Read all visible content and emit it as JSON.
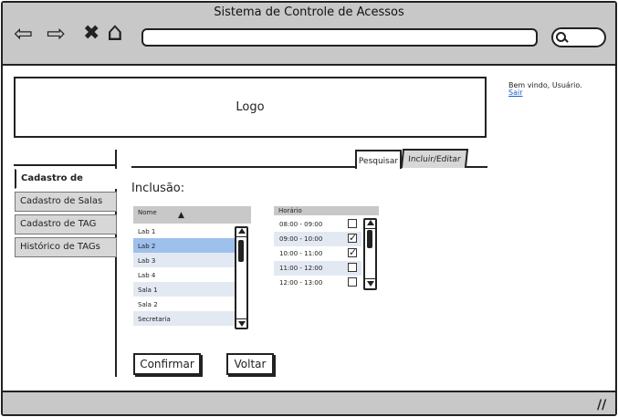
{
  "window": {
    "title": "Sistema de Controle de Acessos",
    "nav_icons": [
      "back-arrow-icon",
      "forward-arrow-icon",
      "stop-x-icon",
      "home-icon"
    ],
    "glyphs": {
      "back": "⇦",
      "forward": "⇨",
      "stop": "✖",
      "home": "⌂"
    },
    "address_value": "",
    "resize_glyph": "//"
  },
  "header": {
    "logo": "Logo",
    "welcome": "Bem vindo, Usuário.",
    "logout": "Sair"
  },
  "sidebar": {
    "items": [
      {
        "label": "Cadastro de Usuários",
        "active": true
      },
      {
        "label": "Cadastro de Salas",
        "active": false
      },
      {
        "label": "Cadastro de TAG",
        "active": false
      },
      {
        "label": "Histórico de TAGs",
        "active": false
      }
    ]
  },
  "tabs": [
    {
      "label": "Pesquisar",
      "active": true
    },
    {
      "label": "Incluir/Editar",
      "active": false
    }
  ],
  "main": {
    "section_title": "Inclusão:",
    "rooms": {
      "header": "Nome",
      "sort_glyph": "▲",
      "items": [
        "Lab 1",
        "Lab 2",
        "Lab 3",
        "Lab 4",
        "Sala 1",
        "Sala 2",
        "Secretaria"
      ],
      "selected": "Lab 2"
    },
    "hours": {
      "header": "Horário",
      "check_glyph": "✓",
      "items": [
        {
          "label": "08:00 - 09:00",
          "checked": false
        },
        {
          "label": "09:00 - 10:00",
          "checked": true
        },
        {
          "label": "10:00 - 11:00",
          "checked": true
        },
        {
          "label": "11:00 - 12:00",
          "checked": false
        },
        {
          "label": "12:00 - 13:00",
          "checked": false
        }
      ]
    },
    "buttons": {
      "confirm": "Confirmar",
      "back": "Voltar"
    }
  },
  "colors": {
    "chrome": "#c8c8c8",
    "selected_row": "#9ec0ec",
    "alt_row": "#e3e9f2",
    "link": "#1a5fd0"
  }
}
